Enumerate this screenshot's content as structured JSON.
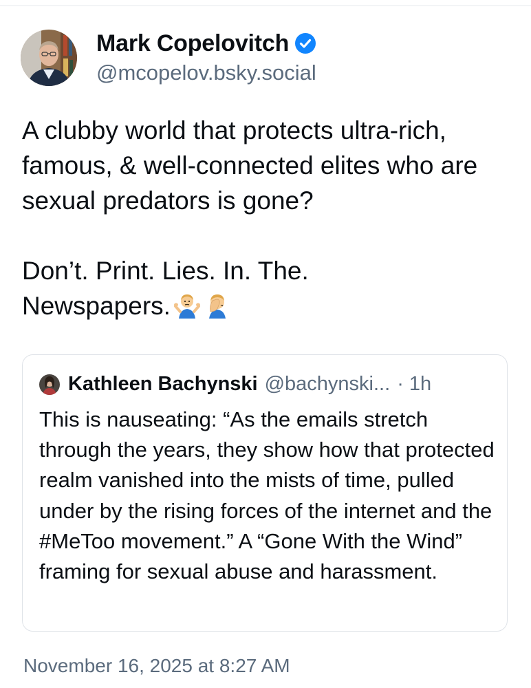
{
  "post": {
    "author_name": "Mark Copelovitch",
    "author_handle": "@mcopelov.bsky.social",
    "text_paragraph_1": "A clubby world that protects ultra-rich, famous, & well-connected elites who are sexual predators is gone?",
    "text_paragraph_2_line_1": "Don’t. Print. Lies. In. The.",
    "text_paragraph_2_line_2": "Newspapers.",
    "emojis": [
      "person-shrugging-emoji",
      "face-palm-emoji"
    ],
    "timestamp": "November 16, 2025 at 8:27 AM"
  },
  "quote": {
    "author_name": "Kathleen Bachynski",
    "author_handle": "@bachynski...",
    "time": "· 1h",
    "text": "This is nauseating: “As the emails stretch through the years, they show how that protected realm vanished into the mists of time, pulled under by the rising forces of the internet and the #MeToo movement.” A “Gone With the Wind” framing for sexual abuse and harassment."
  },
  "colors": {
    "verified": "#1185fe",
    "secondary_text": "#5b6b7d",
    "primary_text": "#0b0f14",
    "card_border": "#dfe3e8"
  }
}
